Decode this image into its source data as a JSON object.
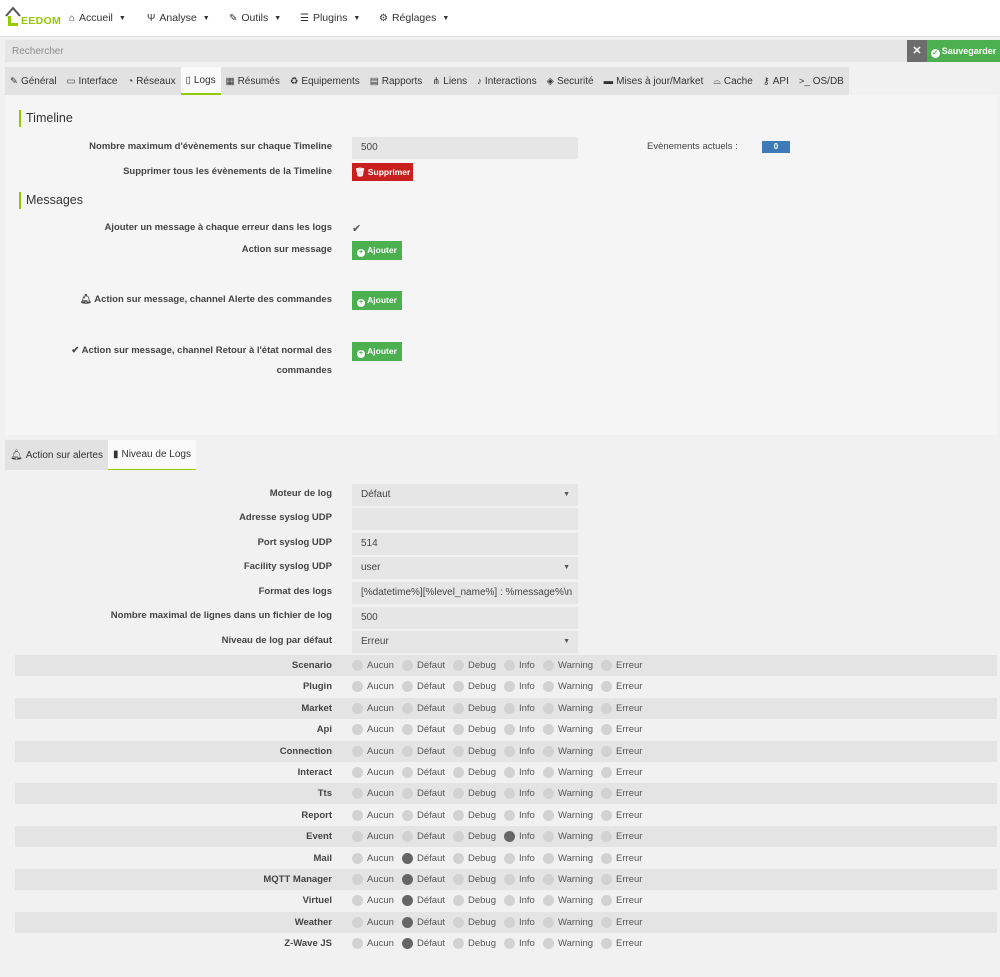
{
  "navbar": {
    "logo_text": "EEDOM",
    "menus": [
      {
        "label": "Accueil",
        "icon": "home-icon"
      },
      {
        "label": "Analyse",
        "icon": "stethoscope-icon"
      },
      {
        "label": "Outils",
        "icon": "wrench-icon"
      },
      {
        "label": "Plugins",
        "icon": "list-icon"
      },
      {
        "label": "Réglages",
        "icon": "gears-icon"
      }
    ]
  },
  "search": {
    "placeholder": "Rechercher",
    "save_label": "Sauvegarder"
  },
  "tabs": [
    {
      "label": "Général",
      "icon": "wrench-icon"
    },
    {
      "label": "Interface",
      "icon": "laptop-icon"
    },
    {
      "label": "Réseaux",
      "icon": "rss-icon"
    },
    {
      "label": "Logs",
      "icon": "file-icon"
    },
    {
      "label": "Résumés",
      "icon": "table-icon"
    },
    {
      "label": "Equipements",
      "icon": "recycle-icon"
    },
    {
      "label": "Rapports",
      "icon": "newspaper-icon"
    },
    {
      "label": "Liens",
      "icon": "sitemap-icon"
    },
    {
      "label": "Interactions",
      "icon": "microphone-icon"
    },
    {
      "label": "Securité",
      "icon": "shield-icon"
    },
    {
      "label": "Mises à jour/Market",
      "icon": "credit-card-icon"
    },
    {
      "label": "Cache",
      "icon": "hdd-icon"
    },
    {
      "label": "API",
      "icon": "key-icon"
    },
    {
      "label": "OS/DB",
      "icon": "terminal-icon"
    }
  ],
  "active_tab": "Logs",
  "timeline": {
    "title": "Timeline",
    "max_events_label": "Nombre maximum d'évènements sur chaque Timeline",
    "max_events_value": "500",
    "current_events_label": "Evènements actuels :",
    "current_events_value": "0",
    "delete_all_label": "Supprimer tous les évènements de la Timeline",
    "delete_button": "Supprimer"
  },
  "messages": {
    "title": "Messages",
    "add_on_error_label": "Ajouter un message à chaque erreur dans les logs",
    "action_label": "Action sur message",
    "alert_channel_label": "Action sur message, channel Alerte des commandes",
    "return_channel_label_1": "Action sur message, channel Retour à l'état normal des",
    "return_channel_label_2": "commandes",
    "add_button": "Ajouter"
  },
  "subtabs": [
    {
      "label": "Action sur alertes",
      "icon": "bell-icon"
    },
    {
      "label": "Niveau de Logs",
      "icon": "file-icon"
    }
  ],
  "log_settings": {
    "engine_label": "Moteur de log",
    "engine_value": "Défaut",
    "syslog_addr_label": "Adresse syslog UDP",
    "syslog_addr_value": "",
    "syslog_port_label": "Port syslog UDP",
    "syslog_port_value": "514",
    "facility_label": "Facility syslog UDP",
    "facility_value": "user",
    "format_label": "Format des logs",
    "format_value": "[%datetime%][%level_name%] : %message%\\n",
    "max_lines_label": "Nombre maximal de lignes dans un fichier de log",
    "max_lines_value": "500",
    "default_level_label": "Niveau de log par défaut",
    "default_level_value": "Erreur"
  },
  "levels": [
    "Aucun",
    "Défaut",
    "Debug",
    "Info",
    "Warning",
    "Erreur"
  ],
  "log_rows": [
    {
      "name": "Scenario",
      "selected": ""
    },
    {
      "name": "Plugin",
      "selected": ""
    },
    {
      "name": "Market",
      "selected": ""
    },
    {
      "name": "Api",
      "selected": ""
    },
    {
      "name": "Connection",
      "selected": ""
    },
    {
      "name": "Interact",
      "selected": ""
    },
    {
      "name": "Tts",
      "selected": ""
    },
    {
      "name": "Report",
      "selected": ""
    },
    {
      "name": "Event",
      "selected": "Info"
    },
    {
      "name": "Mail",
      "selected": "Défaut"
    },
    {
      "name": "MQTT Manager",
      "selected": "Défaut"
    },
    {
      "name": "Virtuel",
      "selected": "Défaut"
    },
    {
      "name": "Weather",
      "selected": "Défaut"
    },
    {
      "name": "Z-Wave JS",
      "selected": "Défaut"
    }
  ]
}
